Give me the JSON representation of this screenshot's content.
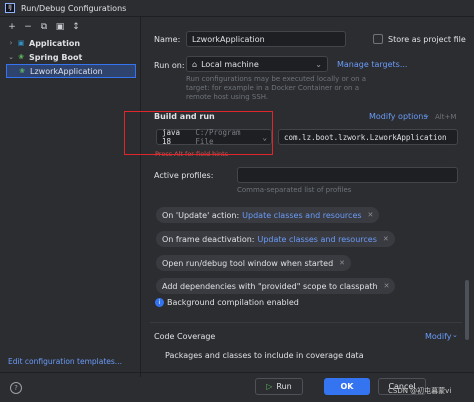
{
  "window": {
    "title": "Run/Debug Configurations",
    "logo_text": "IJ"
  },
  "toolbar": {
    "add": "+",
    "remove": "−",
    "copy": "⧉",
    "save": "▣",
    "sort": "↕"
  },
  "tree": {
    "application": "Application",
    "spring_boot": "Spring Boot",
    "selected_item": "LzworkApplication"
  },
  "footer": {
    "edit_templates": "Edit configuration templates...",
    "help": "?"
  },
  "form": {
    "name_label": "Name:",
    "name_value": "LzworkApplication",
    "store_label": "Store as project file",
    "run_on_label": "Run on:",
    "run_on_value": "Local machine",
    "manage_targets": "Manage targets...",
    "run_on_hint": "Run configurations may be executed locally or on a target: for example in a Docker Container or on a remote host using SSH.",
    "build_and_run": "Build and run",
    "modify_options": "Modify options",
    "modify_shortcut": "Alt+M",
    "jdk_version": "java 18",
    "jdk_path": "C:/Program File",
    "main_class": "com.lz.boot.lzwork.LzworkApplication",
    "error_text": "Press Alt for field hints",
    "active_profiles_label": "Active profiles:",
    "active_profiles_hint": "Comma-separated list of profiles",
    "chips": [
      {
        "label": "On 'Update' action:",
        "value": "Update classes and resources"
      },
      {
        "label": "On frame deactivation:",
        "value": "Update classes and resources"
      },
      {
        "label": "Open run/debug tool window when started",
        "value": ""
      },
      {
        "label": "Add dependencies with \"provided\" scope to classpath",
        "value": ""
      }
    ],
    "background_compilation": "Background compilation enabled",
    "code_coverage": "Code Coverage",
    "modify": "Modify",
    "coverage_packages": "Packages and classes to include in coverage data"
  },
  "buttons": {
    "run": "Run",
    "ok": "OK",
    "cancel": "Cancel"
  },
  "watermark": "CSDN @初屯暮蒙vi"
}
